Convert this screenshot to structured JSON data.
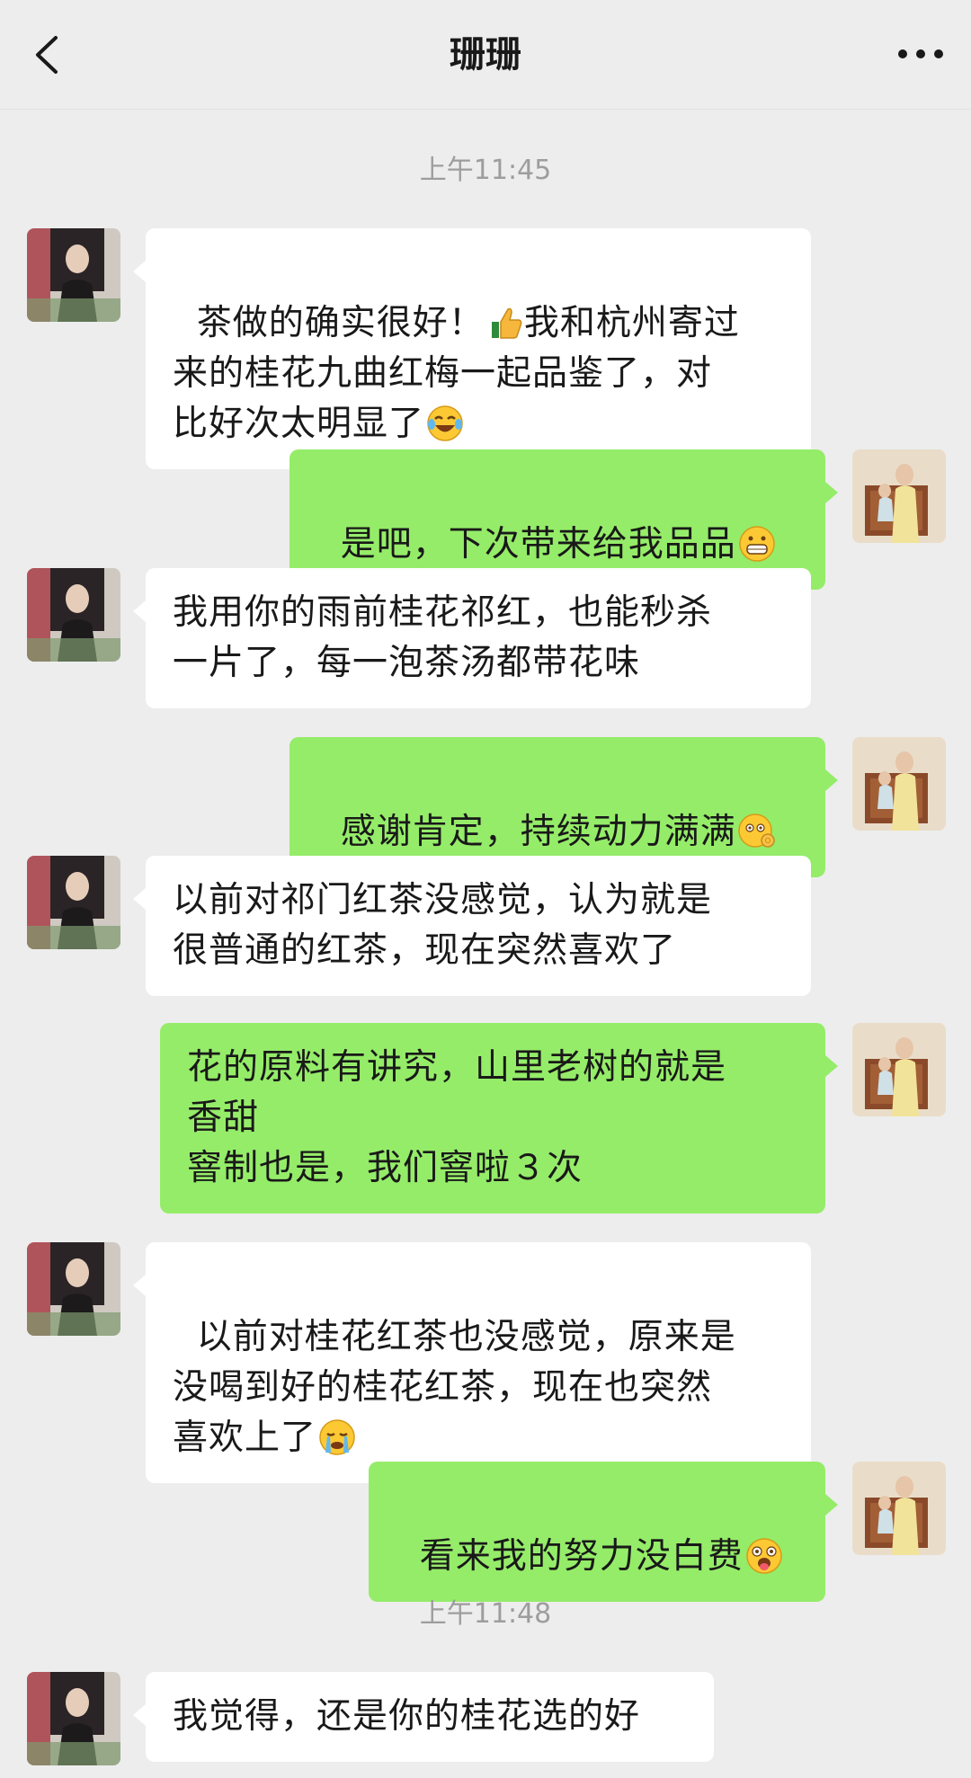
{
  "header": {
    "title": "珊珊",
    "back_icon": "chevron-left-icon",
    "more_icon": "more-dots-icon"
  },
  "colors": {
    "background": "#ededed",
    "incoming_bubble": "#ffffff",
    "outgoing_bubble": "#95ec69",
    "timestamp": "#9d9d9d"
  },
  "timestamps": {
    "t1": "上午11:45",
    "t2": "上午11:48"
  },
  "messages": {
    "m1": {
      "side": "incoming",
      "text_a": "茶做的确实很好！",
      "text_b": "我和杭州寄过\n来的桂花九曲红梅一起品鉴了，对\n比好次太明显了",
      "emoji_a": "thumbs-up-icon",
      "emoji_b": "laughing-tears-icon"
    },
    "m2": {
      "side": "outgoing",
      "text": "是吧，下次带来给我品品",
      "emoji": "grinning-face-icon"
    },
    "m3": {
      "side": "incoming",
      "text": "我用你的雨前桂花祁红，也能秒杀\n一片了，每一泡茶汤都带花味"
    },
    "m4": {
      "side": "outgoing",
      "text": "感谢肯定，持续动力满满",
      "emoji": "face-ok-hand-icon"
    },
    "m5": {
      "side": "incoming",
      "text": "以前对祁门红茶没感觉，认为就是\n很普通的红茶，现在突然喜欢了"
    },
    "m6": {
      "side": "outgoing",
      "text": "花的原料有讲究，山里老树的就是\n香甜\n窨制也是，我们窨啦３次"
    },
    "m7": {
      "side": "incoming",
      "text": "以前对桂花红茶也没感觉，原来是\n没喝到好的桂花红茶，现在也突然\n喜欢上了",
      "emoji": "crying-face-icon"
    },
    "m8": {
      "side": "outgoing",
      "text": "看来我的努力没白费",
      "emoji": "surprised-tongue-face-icon"
    },
    "m9": {
      "side": "incoming",
      "text": "我觉得，还是你的桂花选的好"
    }
  }
}
